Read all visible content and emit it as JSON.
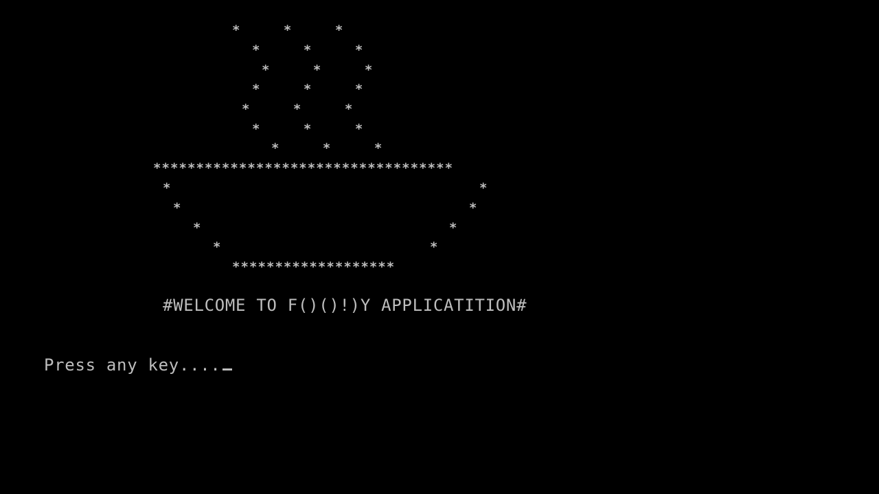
{
  "screen": {
    "background": "#000000",
    "foreground": "#bdbdbd",
    "art_lines": [
      "*     *     *",
      "*     *     *",
      "*     *     *",
      "*     *     *",
      "*     *     *",
      "*     *     *",
      "*     *     *",
      "***********************************",
      "*",
      "*",
      "*",
      "*",
      "*",
      "*",
      "*",
      "*",
      "*******************"
    ],
    "welcome_text": "#WELCOME TO F()()!)Y APPLICATITION#",
    "prompt_text": "Press any key....",
    "cursor": "_"
  }
}
